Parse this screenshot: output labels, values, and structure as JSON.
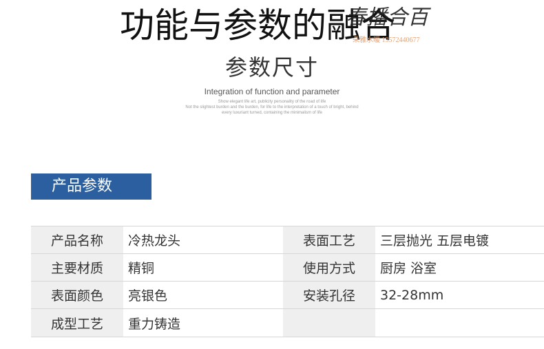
{
  "header": {
    "title": "功能与参数的融合",
    "subtitle": "参数尺寸",
    "english_title": "Integration of function and parameter",
    "fine_print": [
      "Show elegant life art, publicity personality of the road of life",
      "Not the slightest burden and the burden, for life to the interpretation of a touch of bright, behind",
      "every luxuriant turned, containing the minimalism of life"
    ]
  },
  "watermark": {
    "text": "春播合百",
    "subtext": "朵雅水暖  13572440677"
  },
  "section": {
    "title": "产品参数"
  },
  "params": {
    "rows": [
      {
        "label1": "产品名称",
        "value1": "冷热龙头",
        "label2": "表面工艺",
        "value2": "三层抛光 五层电镀"
      },
      {
        "label1": "主要材质",
        "value1": "精铜",
        "label2": "使用方式",
        "value2": "厨房 浴室"
      },
      {
        "label1": "表面颜色",
        "value1": "亮银色",
        "label2": "安装孔径",
        "value2": "32-28mm"
      },
      {
        "label1": "成型工艺",
        "value1": "重力铸造",
        "label2": "",
        "value2": ""
      }
    ]
  },
  "colors": {
    "banner": "#2b5f9f",
    "label_bg": "#efefef",
    "border": "#d6d6d6"
  }
}
